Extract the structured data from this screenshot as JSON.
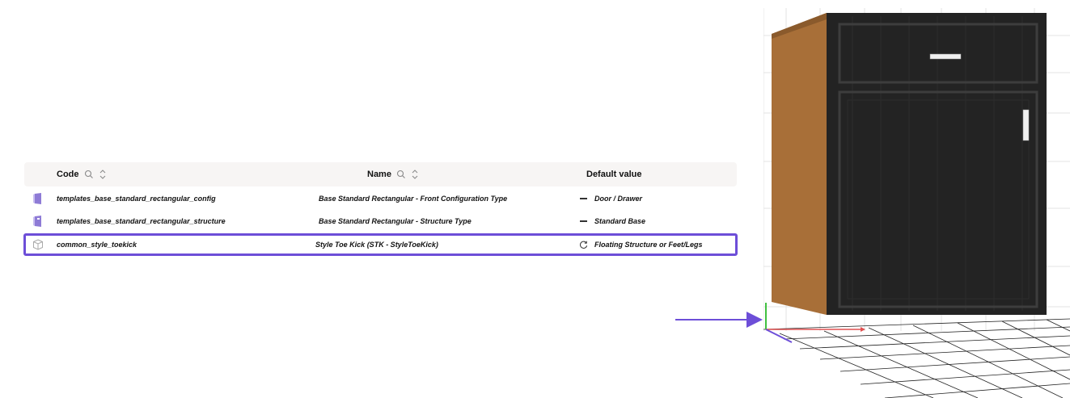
{
  "table": {
    "columns": [
      {
        "label": "Code",
        "searchable": true,
        "sortable": true
      },
      {
        "label": "Name",
        "searchable": true,
        "sortable": true
      },
      {
        "label": "Default value",
        "searchable": false,
        "sortable": false
      }
    ],
    "rows": [
      {
        "icon": "config-panel-icon",
        "code": "templates_base_standard_rectangular_config",
        "name": "Base Standard Rectangular - Front Configuration Type",
        "default_marker": "dash",
        "default_value": "Door / Drawer"
      },
      {
        "icon": "structure-panel-icon",
        "code": "templates_base_standard_rectangular_structure",
        "name": "Base Standard Rectangular - Structure Type",
        "default_marker": "dash",
        "default_value": "Standard Base"
      },
      {
        "icon": "cube-icon",
        "code": "common_style_toekick",
        "name": "Style Toe Kick (STK - StyleToeKick)",
        "default_marker": "reset",
        "default_value": "Floating Structure or Feet/Legs",
        "highlighted": true
      }
    ]
  },
  "colors": {
    "highlight": "#6d4ed8",
    "header_bg": "#f7f5f4",
    "cabinet_front": "#222222",
    "cabinet_side": "#a86f38",
    "axis_x": "#e05050",
    "axis_y": "#40c040",
    "axis_z": "#6d4ed8"
  },
  "viewport": {
    "object": "base-cabinet-door-drawer",
    "grid": true,
    "axes": true
  }
}
